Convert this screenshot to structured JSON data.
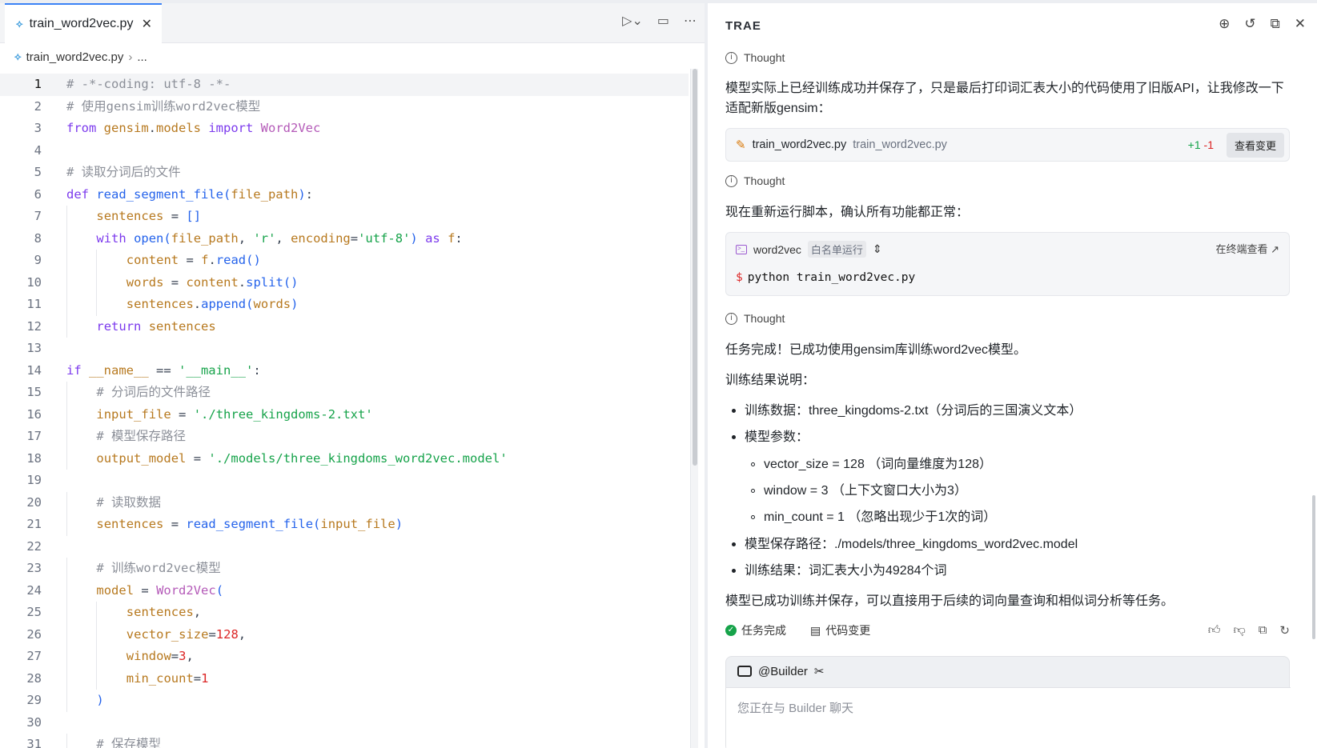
{
  "editor": {
    "tab_label": "train_word2vec.py",
    "breadcrumb_file": "train_word2vec.py",
    "breadcrumb_more": "...",
    "lines": [
      {
        "n": "1",
        "active": true,
        "indent": 0,
        "tokens": [
          [
            "cm",
            "# -*-coding: utf-8 -*-"
          ]
        ]
      },
      {
        "n": "2",
        "indent": 0,
        "tokens": [
          [
            "cm",
            "# 使用gensim训练word2vec模型"
          ]
        ]
      },
      {
        "n": "3",
        "indent": 0,
        "tokens": [
          [
            "k",
            "from "
          ],
          [
            "vr",
            "gensim"
          ],
          [
            "pl",
            "."
          ],
          [
            "vr",
            "models"
          ],
          [
            "k",
            " import "
          ],
          [
            "cls",
            "Word2Vec"
          ]
        ]
      },
      {
        "n": "4",
        "indent": 0,
        "tokens": []
      },
      {
        "n": "5",
        "indent": 0,
        "tokens": [
          [
            "cm",
            "# 读取分词后的文件"
          ]
        ]
      },
      {
        "n": "6",
        "indent": 0,
        "tokens": [
          [
            "k",
            "def "
          ],
          [
            "fn",
            "read_segment_file"
          ],
          [
            "pn",
            "("
          ],
          [
            "vr",
            "file_path"
          ],
          [
            "pn",
            ")"
          ],
          [
            "pl",
            ":"
          ]
        ]
      },
      {
        "n": "7",
        "indent": 1,
        "tokens": [
          [
            "vr",
            "sentences"
          ],
          [
            "pl",
            " = "
          ],
          [
            "pn",
            "[]"
          ]
        ]
      },
      {
        "n": "8",
        "indent": 1,
        "tokens": [
          [
            "k",
            "with "
          ],
          [
            "fn",
            "open"
          ],
          [
            "pn",
            "("
          ],
          [
            "vr",
            "file_path"
          ],
          [
            "pl",
            ", "
          ],
          [
            "st",
            "'r'"
          ],
          [
            "pl",
            ", "
          ],
          [
            "vr",
            "encoding"
          ],
          [
            "pl",
            "="
          ],
          [
            "st",
            "'utf-8'"
          ],
          [
            "pn",
            ")"
          ],
          [
            "k",
            " as "
          ],
          [
            "vr",
            "f"
          ],
          [
            "pl",
            ":"
          ]
        ]
      },
      {
        "n": "9",
        "indent": 2,
        "tokens": [
          [
            "vr",
            "content"
          ],
          [
            "pl",
            " = "
          ],
          [
            "vr",
            "f"
          ],
          [
            "pl",
            "."
          ],
          [
            "fn",
            "read"
          ],
          [
            "pn",
            "()"
          ]
        ]
      },
      {
        "n": "10",
        "indent": 2,
        "tokens": [
          [
            "vr",
            "words"
          ],
          [
            "pl",
            " = "
          ],
          [
            "vr",
            "content"
          ],
          [
            "pl",
            "."
          ],
          [
            "fn",
            "split"
          ],
          [
            "pn",
            "()"
          ]
        ]
      },
      {
        "n": "11",
        "indent": 2,
        "tokens": [
          [
            "vr",
            "sentences"
          ],
          [
            "pl",
            "."
          ],
          [
            "fn",
            "append"
          ],
          [
            "pn",
            "("
          ],
          [
            "vr",
            "words"
          ],
          [
            "pn",
            ")"
          ]
        ]
      },
      {
        "n": "12",
        "indent": 1,
        "tokens": [
          [
            "k",
            "return "
          ],
          [
            "vr",
            "sentences"
          ]
        ]
      },
      {
        "n": "13",
        "indent": 0,
        "tokens": []
      },
      {
        "n": "14",
        "indent": 0,
        "tokens": [
          [
            "k",
            "if "
          ],
          [
            "vr",
            "__name__"
          ],
          [
            "pl",
            " == "
          ],
          [
            "st",
            "'__main__'"
          ],
          [
            "pl",
            ":"
          ]
        ]
      },
      {
        "n": "15",
        "indent": 1,
        "tokens": [
          [
            "cm",
            "# 分词后的文件路径"
          ]
        ]
      },
      {
        "n": "16",
        "indent": 1,
        "tokens": [
          [
            "vr",
            "input_file"
          ],
          [
            "pl",
            " = "
          ],
          [
            "st",
            "'./three_kingdoms-2.txt'"
          ]
        ]
      },
      {
        "n": "17",
        "indent": 1,
        "tokens": [
          [
            "cm",
            "# 模型保存路径"
          ]
        ]
      },
      {
        "n": "18",
        "indent": 1,
        "tokens": [
          [
            "vr",
            "output_model"
          ],
          [
            "pl",
            " = "
          ],
          [
            "st",
            "'./models/three_kingdoms_word2vec.model'"
          ]
        ]
      },
      {
        "n": "19",
        "indent": 0,
        "tokens": []
      },
      {
        "n": "20",
        "indent": 1,
        "tokens": [
          [
            "cm",
            "# 读取数据"
          ]
        ]
      },
      {
        "n": "21",
        "indent": 1,
        "tokens": [
          [
            "vr",
            "sentences"
          ],
          [
            "pl",
            " = "
          ],
          [
            "fn",
            "read_segment_file"
          ],
          [
            "pn",
            "("
          ],
          [
            "vr",
            "input_file"
          ],
          [
            "pn",
            ")"
          ]
        ]
      },
      {
        "n": "22",
        "indent": 0,
        "tokens": []
      },
      {
        "n": "23",
        "indent": 1,
        "tokens": [
          [
            "cm",
            "# 训练word2vec模型"
          ]
        ]
      },
      {
        "n": "24",
        "indent": 1,
        "tokens": [
          [
            "vr",
            "model"
          ],
          [
            "pl",
            " = "
          ],
          [
            "cls",
            "Word2Vec"
          ],
          [
            "pn",
            "("
          ]
        ]
      },
      {
        "n": "25",
        "indent": 2,
        "tokens": [
          [
            "vr",
            "sentences"
          ],
          [
            "pl",
            ","
          ]
        ]
      },
      {
        "n": "26",
        "indent": 2,
        "tokens": [
          [
            "vr",
            "vector_size"
          ],
          [
            "pl",
            "="
          ],
          [
            "nm",
            "128"
          ],
          [
            "pl",
            ","
          ]
        ]
      },
      {
        "n": "27",
        "indent": 2,
        "tokens": [
          [
            "vr",
            "window"
          ],
          [
            "pl",
            "="
          ],
          [
            "nm",
            "3"
          ],
          [
            "pl",
            ","
          ]
        ]
      },
      {
        "n": "28",
        "indent": 2,
        "tokens": [
          [
            "vr",
            "min_count"
          ],
          [
            "pl",
            "="
          ],
          [
            "nm",
            "1"
          ]
        ]
      },
      {
        "n": "29",
        "indent": 1,
        "tokens": [
          [
            "pn",
            ")"
          ]
        ]
      },
      {
        "n": "30",
        "indent": 0,
        "tokens": []
      },
      {
        "n": "31",
        "indent": 1,
        "tokens": [
          [
            "cm",
            "# 保存模型"
          ]
        ]
      }
    ]
  },
  "panel": {
    "brand": "TRAE",
    "thought_label": "Thought",
    "msg1": "模型实际上已经训练成功并保存了，只是最后打印词汇表大小的代码使用了旧版API，让我修改一下适配新版gensim：",
    "file_card": {
      "name": "train_word2vec.py",
      "path": "train_word2vec.py",
      "plus": "+1",
      "minus": "-1",
      "button": "查看变更"
    },
    "msg2": "现在重新运行脚本，确认所有功能都正常：",
    "terminal": {
      "name": "word2vec",
      "mode": "白名单运行",
      "open_label": "在终端查看",
      "command": "python train_word2vec.py"
    },
    "msg3": "任务完成！已成功使用gensim库训练word2vec模型。",
    "msg4": "训练结果说明：",
    "bullets": {
      "b1": "训练数据：three_kingdoms-2.txt（分词后的三国演义文本）",
      "b2": "模型参数：",
      "s1": "vector_size = 128 （词向量维度为128）",
      "s2": "window = 3 （上下文窗口大小为3）",
      "s3": "min_count = 1 （忽略出现少于1次的词）",
      "b3": "模型保存路径：./models/three_kingdoms_word2vec.model",
      "b4": "训练结果：词汇表大小为49284个词"
    },
    "msg5": "模型已成功训练并保存，可以直接用于后续的词向量查询和相似词分析等任务。",
    "status_done": "任务完成",
    "status_changes": "代码变更",
    "agent": "@Builder",
    "input_placeholder": "您正在与 Builder 聊天"
  },
  "colors": {
    "keyword": "#7c3aed",
    "function": "#2563eb",
    "variable": "#b7791f",
    "string": "#16a34a",
    "comment": "#8b8f98",
    "number": "#dc2626",
    "accent": "#3b82f6"
  }
}
